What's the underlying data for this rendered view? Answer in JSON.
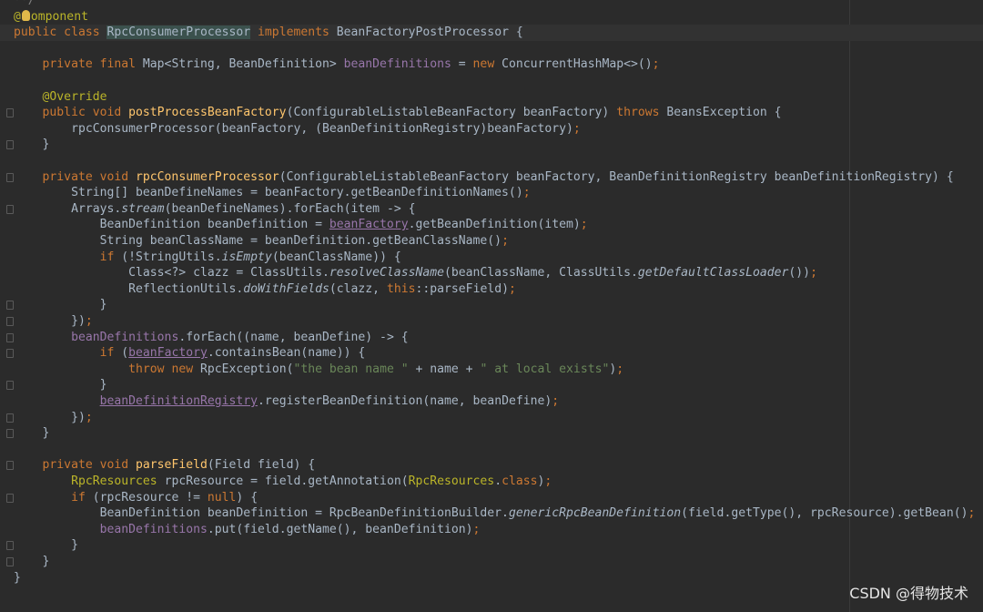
{
  "editor": {
    "lines": [
      {
        "segments": [
          {
            "t": "**/",
            "c": "cmt"
          }
        ]
      },
      {
        "segments": [
          {
            "t": "@",
            "c": "ann"
          },
          {
            "t": "bulb",
            "c": "icon"
          },
          {
            "t": "omponent",
            "c": "ann"
          }
        ]
      },
      {
        "segments": [
          {
            "t": "public class ",
            "c": "kw"
          },
          {
            "t": "RpcConsumerProcessor",
            "c": "hlc"
          },
          {
            "t": " implements ",
            "c": "kw"
          },
          {
            "t": "BeanFactoryPostProcessor {",
            "c": ""
          }
        ],
        "caret": true
      },
      {
        "segments": []
      },
      {
        "segments": [
          {
            "t": "    private final ",
            "c": "kw"
          },
          {
            "t": "Map<String, BeanDefinition> ",
            "c": ""
          },
          {
            "t": "beanDefinitions",
            "c": "fld"
          },
          {
            "t": " = ",
            "c": ""
          },
          {
            "t": "new ",
            "c": "kw"
          },
          {
            "t": "ConcurrentHashMap<>()",
            "c": ""
          },
          {
            "t": ";",
            "c": "kw"
          }
        ]
      },
      {
        "segments": []
      },
      {
        "segments": [
          {
            "t": "    @Override",
            "c": "ann"
          }
        ]
      },
      {
        "segments": [
          {
            "t": "    public void ",
            "c": "kw"
          },
          {
            "t": "postProcessBeanFactory",
            "c": "fn"
          },
          {
            "t": "(ConfigurableListableBeanFactory beanFactory) ",
            "c": ""
          },
          {
            "t": "throws ",
            "c": "kw"
          },
          {
            "t": "BeansException {",
            "c": ""
          }
        ]
      },
      {
        "segments": [
          {
            "t": "        rpcConsumerProcessor(beanFactory, (BeanDefinitionRegistry)beanFactory)",
            "c": ""
          },
          {
            "t": ";",
            "c": "kw"
          }
        ]
      },
      {
        "segments": [
          {
            "t": "    }",
            "c": ""
          }
        ]
      },
      {
        "segments": []
      },
      {
        "segments": [
          {
            "t": "    private void ",
            "c": "kw"
          },
          {
            "t": "rpcConsumerProcessor",
            "c": "fn"
          },
          {
            "t": "(ConfigurableListableBeanFactory beanFactory, BeanDefinitionRegistry beanDefinitionRegistry) {",
            "c": ""
          }
        ]
      },
      {
        "segments": [
          {
            "t": "        String[] beanDefineNames = beanFactory.getBeanDefinitionNames()",
            "c": ""
          },
          {
            "t": ";",
            "c": "kw"
          }
        ]
      },
      {
        "segments": [
          {
            "t": "        Arrays.",
            "c": ""
          },
          {
            "t": "stream",
            "c": "ital"
          },
          {
            "t": "(beanDefineNames).forEach(item -> {",
            "c": ""
          }
        ]
      },
      {
        "segments": [
          {
            "t": "            BeanDefinition beanDefinition = ",
            "c": ""
          },
          {
            "t": "beanFactory",
            "c": "und"
          },
          {
            "t": ".getBeanDefinition(item)",
            "c": ""
          },
          {
            "t": ";",
            "c": "kw"
          }
        ]
      },
      {
        "segments": [
          {
            "t": "            String beanClassName = beanDefinition.getBeanClassName()",
            "c": ""
          },
          {
            "t": ";",
            "c": "kw"
          }
        ]
      },
      {
        "segments": [
          {
            "t": "            ",
            "c": ""
          },
          {
            "t": "if ",
            "c": "kw"
          },
          {
            "t": "(!StringUtils.",
            "c": ""
          },
          {
            "t": "isEmpty",
            "c": "ital"
          },
          {
            "t": "(beanClassName)) {",
            "c": ""
          }
        ]
      },
      {
        "segments": [
          {
            "t": "                Class<?> clazz = ClassUtils.",
            "c": ""
          },
          {
            "t": "resolveClassName",
            "c": "ital"
          },
          {
            "t": "(beanClassName, ClassUtils.",
            "c": ""
          },
          {
            "t": "getDefaultClassLoader",
            "c": "ital"
          },
          {
            "t": "())",
            "c": ""
          },
          {
            "t": ";",
            "c": "kw"
          }
        ]
      },
      {
        "segments": [
          {
            "t": "                ReflectionUtils.",
            "c": ""
          },
          {
            "t": "doWithFields",
            "c": "ital"
          },
          {
            "t": "(clazz, ",
            "c": ""
          },
          {
            "t": "this",
            "c": "kw"
          },
          {
            "t": "::parseField)",
            "c": ""
          },
          {
            "t": ";",
            "c": "kw"
          }
        ]
      },
      {
        "segments": [
          {
            "t": "            }",
            "c": ""
          }
        ]
      },
      {
        "segments": [
          {
            "t": "        })",
            "c": ""
          },
          {
            "t": ";",
            "c": "kw"
          }
        ]
      },
      {
        "segments": [
          {
            "t": "        ",
            "c": ""
          },
          {
            "t": "beanDefinitions",
            "c": "fld"
          },
          {
            "t": ".forEach((name, beanDefine) -> {",
            "c": ""
          }
        ]
      },
      {
        "segments": [
          {
            "t": "            ",
            "c": ""
          },
          {
            "t": "if ",
            "c": "kw"
          },
          {
            "t": "(",
            "c": ""
          },
          {
            "t": "beanFactory",
            "c": "und"
          },
          {
            "t": ".containsBean(name)) {",
            "c": ""
          }
        ]
      },
      {
        "segments": [
          {
            "t": "                ",
            "c": ""
          },
          {
            "t": "throw new ",
            "c": "kw"
          },
          {
            "t": "RpcException(",
            "c": ""
          },
          {
            "t": "\"the bean name \"",
            "c": "str"
          },
          {
            "t": " + name + ",
            "c": ""
          },
          {
            "t": "\" at local exists\"",
            "c": "str"
          },
          {
            "t": ")",
            "c": ""
          },
          {
            "t": ";",
            "c": "kw"
          }
        ]
      },
      {
        "segments": [
          {
            "t": "            }",
            "c": ""
          }
        ]
      },
      {
        "segments": [
          {
            "t": "            ",
            "c": ""
          },
          {
            "t": "beanDefinitionRegistry",
            "c": "und"
          },
          {
            "t": ".registerBeanDefinition(name, beanDefine)",
            "c": ""
          },
          {
            "t": ";",
            "c": "kw"
          }
        ]
      },
      {
        "segments": [
          {
            "t": "        })",
            "c": ""
          },
          {
            "t": ";",
            "c": "kw"
          }
        ]
      },
      {
        "segments": [
          {
            "t": "    }",
            "c": ""
          }
        ]
      },
      {
        "segments": []
      },
      {
        "segments": [
          {
            "t": "    private void ",
            "c": "kw"
          },
          {
            "t": "parseField",
            "c": "fn"
          },
          {
            "t": "(Field field) {",
            "c": ""
          }
        ]
      },
      {
        "segments": [
          {
            "t": "        ",
            "c": ""
          },
          {
            "t": "RpcResources ",
            "c": "ann"
          },
          {
            "t": "rpcResource = field.getAnnotation(",
            "c": ""
          },
          {
            "t": "RpcResources",
            "c": "ann"
          },
          {
            "t": ".",
            "c": ""
          },
          {
            "t": "class",
            "c": "kw"
          },
          {
            "t": ")",
            "c": ""
          },
          {
            "t": ";",
            "c": "kw"
          }
        ]
      },
      {
        "segments": [
          {
            "t": "        ",
            "c": ""
          },
          {
            "t": "if ",
            "c": "kw"
          },
          {
            "t": "(rpcResource != ",
            "c": ""
          },
          {
            "t": "null",
            "c": "kw"
          },
          {
            "t": ") {",
            "c": ""
          }
        ]
      },
      {
        "segments": [
          {
            "t": "            BeanDefinition beanDefinition = RpcBeanDefinitionBuilder.",
            "c": ""
          },
          {
            "t": "genericRpcBeanDefinition",
            "c": "ital"
          },
          {
            "t": "(field.getType(), rpcResource).getBean()",
            "c": ""
          },
          {
            "t": ";",
            "c": "kw"
          }
        ]
      },
      {
        "segments": [
          {
            "t": "            ",
            "c": ""
          },
          {
            "t": "beanDefinitions",
            "c": "fld"
          },
          {
            "t": ".put(field.getName(), beanDefinition)",
            "c": ""
          },
          {
            "t": ";",
            "c": "kw"
          }
        ]
      },
      {
        "segments": [
          {
            "t": "        }",
            "c": ""
          }
        ]
      },
      {
        "segments": [
          {
            "t": "    }",
            "c": ""
          }
        ]
      },
      {
        "segments": [
          {
            "t": "}",
            "c": ""
          }
        ]
      }
    ]
  },
  "watermark": "CSDN @得物技术"
}
